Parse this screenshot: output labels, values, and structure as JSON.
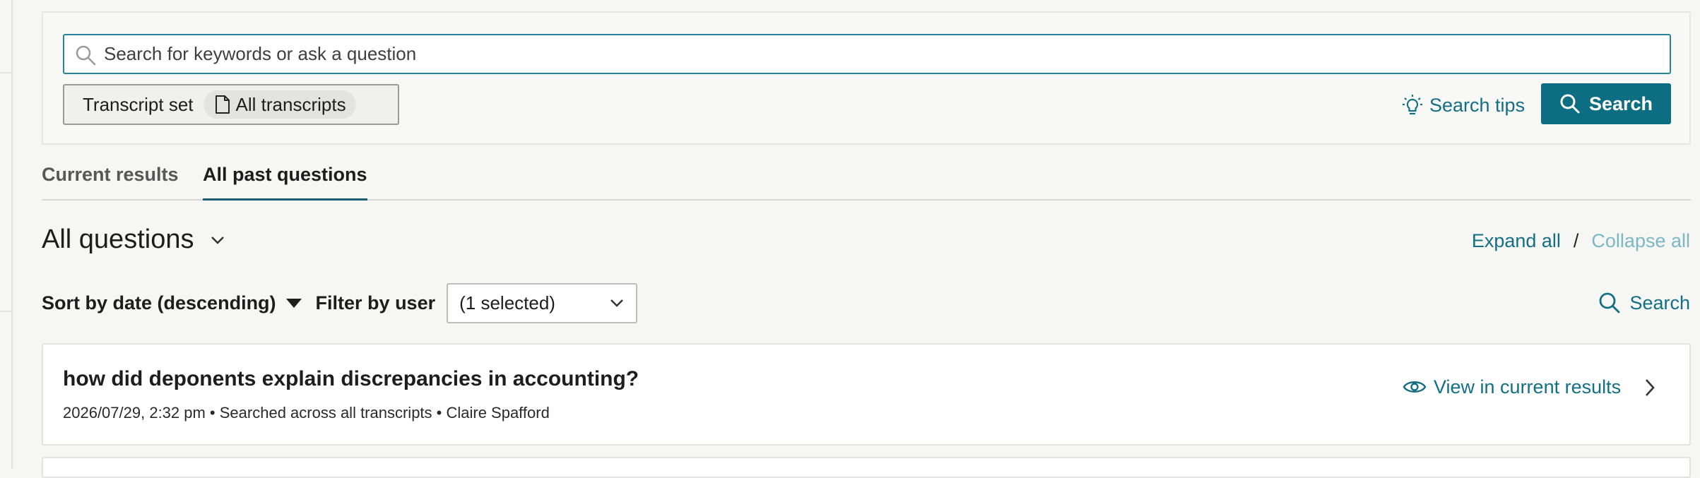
{
  "search": {
    "placeholder": "Search for keywords or ask a question",
    "value": "",
    "transcript_set_label": "Transcript set",
    "transcript_set_value": "All transcripts",
    "tips_label": "Search tips",
    "search_button_label": "Search"
  },
  "tabs": [
    {
      "label": "Current results",
      "active": false
    },
    {
      "label": "All past questions",
      "active": true
    }
  ],
  "questions": {
    "title": "All questions",
    "expand_all": "Expand all",
    "separator": "/",
    "collapse_all": "Collapse all",
    "sort_label": "Sort by date (descending)",
    "filter_label": "Filter by user",
    "filter_value": "(1 selected)",
    "search_link": "Search"
  },
  "items": [
    {
      "question": "how did deponents explain discrepancies in accounting?",
      "meta": "2026/07/29, 2:32 pm • Searched across all transcripts • Claire Spafford",
      "view_label": "View in current results"
    }
  ],
  "colors": {
    "accent": "#0d6e83",
    "link": "#136f84",
    "link_disabled": "#7cb7c4",
    "focus_border": "#26859a"
  },
  "icons": {
    "search": "magnifier-icon",
    "doc": "document-icon",
    "tips": "lightbulb-icon",
    "dropdown": "chevron-down-icon",
    "view": "eye-icon",
    "next": "chevron-right-icon"
  }
}
